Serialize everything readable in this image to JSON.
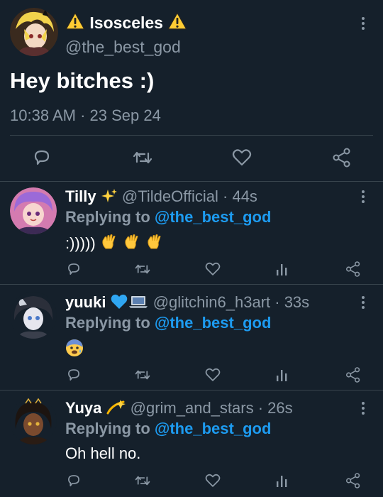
{
  "main_tweet": {
    "display_name": "Isosceles",
    "handle": "@the_best_god",
    "text": "Hey bitches :)",
    "timestamp": "10:38 AM · 23 Sep 24",
    "name_icons": [
      "warning-icon",
      "warning-icon"
    ]
  },
  "action_icons": [
    "reply-icon",
    "retweet-icon",
    "like-icon",
    "share-icon",
    "views-icon"
  ],
  "replying_to_label": "Replying to",
  "replies": [
    {
      "display_name": "Tilly",
      "name_emoji": "sparkles-icon",
      "handle_time": "@TildeOfficial · 44s",
      "mention": "@the_best_god",
      "text": ":)))))",
      "text_emojis": [
        "waving-hand-icon",
        "waving-hand-icon",
        "waving-hand-icon"
      ]
    },
    {
      "display_name": "yuuki",
      "name_emoji": "blue-heart-and-laptop-icon",
      "handle_time": "@glitchin6_h3art · 33s",
      "mention": "@the_best_god",
      "text": "",
      "text_emojis": [
        "anxious-face-icon"
      ]
    },
    {
      "display_name": "Yuya",
      "name_emoji": "dizzy-icon",
      "handle_time": "@grim_and_stars · 26s",
      "mention": "@the_best_god",
      "text": "Oh hell no.",
      "text_emojis": []
    }
  ],
  "colors": {
    "background": "#15202b",
    "text": "#ffffff",
    "secondary": "#8b98a5",
    "accent": "#1d9bf0",
    "divider": "#38444d"
  }
}
